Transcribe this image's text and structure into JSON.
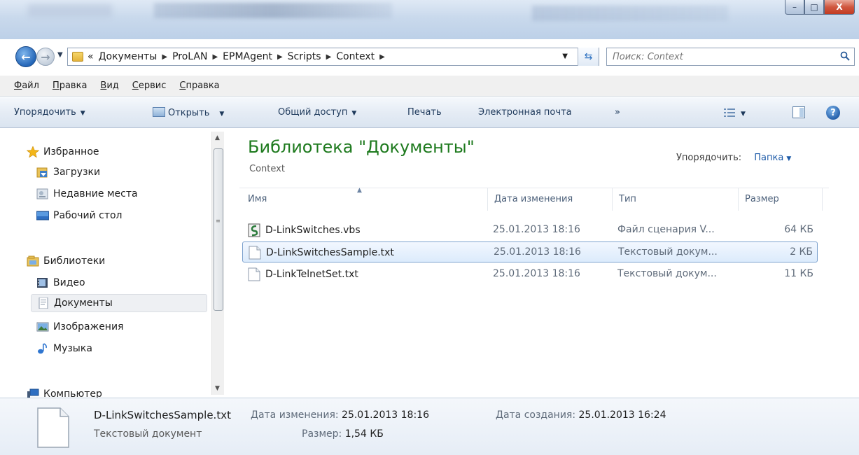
{
  "address": {
    "breadcrumb_prefix": "«",
    "crumbs": [
      "Документы",
      "ProLAN",
      "EPMAgent",
      "Scripts",
      "Context"
    ],
    "search_placeholder": "Поиск: Context"
  },
  "window_controls": {
    "minimize": "–",
    "maximize": "□",
    "close": "X"
  },
  "menu": [
    "Файл",
    "Правка",
    "Вид",
    "Сервис",
    "Справка"
  ],
  "toolbar": {
    "organize": "Упорядочить",
    "open": "Открыть",
    "share": "Общий доступ",
    "print": "Печать",
    "email": "Электронная почта",
    "more": "»",
    "help": "?"
  },
  "navigation": {
    "favorites": "Избранное",
    "downloads": "Загрузки",
    "recent": "Недавние места",
    "desktop": "Рабочий стол",
    "libraries": "Библиотеки",
    "video": "Видео",
    "documents": "Документы",
    "images": "Изображения",
    "music": "Музыка",
    "computer": "Компьютер"
  },
  "library": {
    "title": "Библиотека \"Документы\"",
    "subtitle": "Context",
    "arrange_label": "Упорядочить:",
    "arrange_value": "Папка"
  },
  "columns": {
    "name": "Имя",
    "date": "Дата изменения",
    "type": "Тип",
    "size": "Размер"
  },
  "files": [
    {
      "name": "D-LinkSwitches.vbs",
      "date": "25.01.2013 18:16",
      "type": "Файл сценария V...",
      "size": "64 КБ",
      "icon": "vbs-script-icon"
    },
    {
      "name": "D-LinkSwitchesSample.txt",
      "date": "25.01.2013 18:16",
      "type": "Текстовый докум...",
      "size": "2 КБ",
      "icon": "text-file-icon"
    },
    {
      "name": "D-LinkTelnetSet.txt",
      "date": "25.01.2013 18:16",
      "type": "Текстовый докум...",
      "size": "11 КБ",
      "icon": "text-file-icon"
    }
  ],
  "details": {
    "name": "D-LinkSwitchesSample.txt",
    "type": "Текстовый документ",
    "modified_label": "Дата изменения:",
    "modified_value": "25.01.2013 18:16",
    "size_label": "Размер:",
    "size_value": "1,54 КБ",
    "created_label": "Дата создания:",
    "created_value": "25.01.2013 16:24"
  },
  "colors": {
    "library_title": "#1e7a1e",
    "link": "#1c5aa8",
    "selection": "#dcebfc"
  }
}
